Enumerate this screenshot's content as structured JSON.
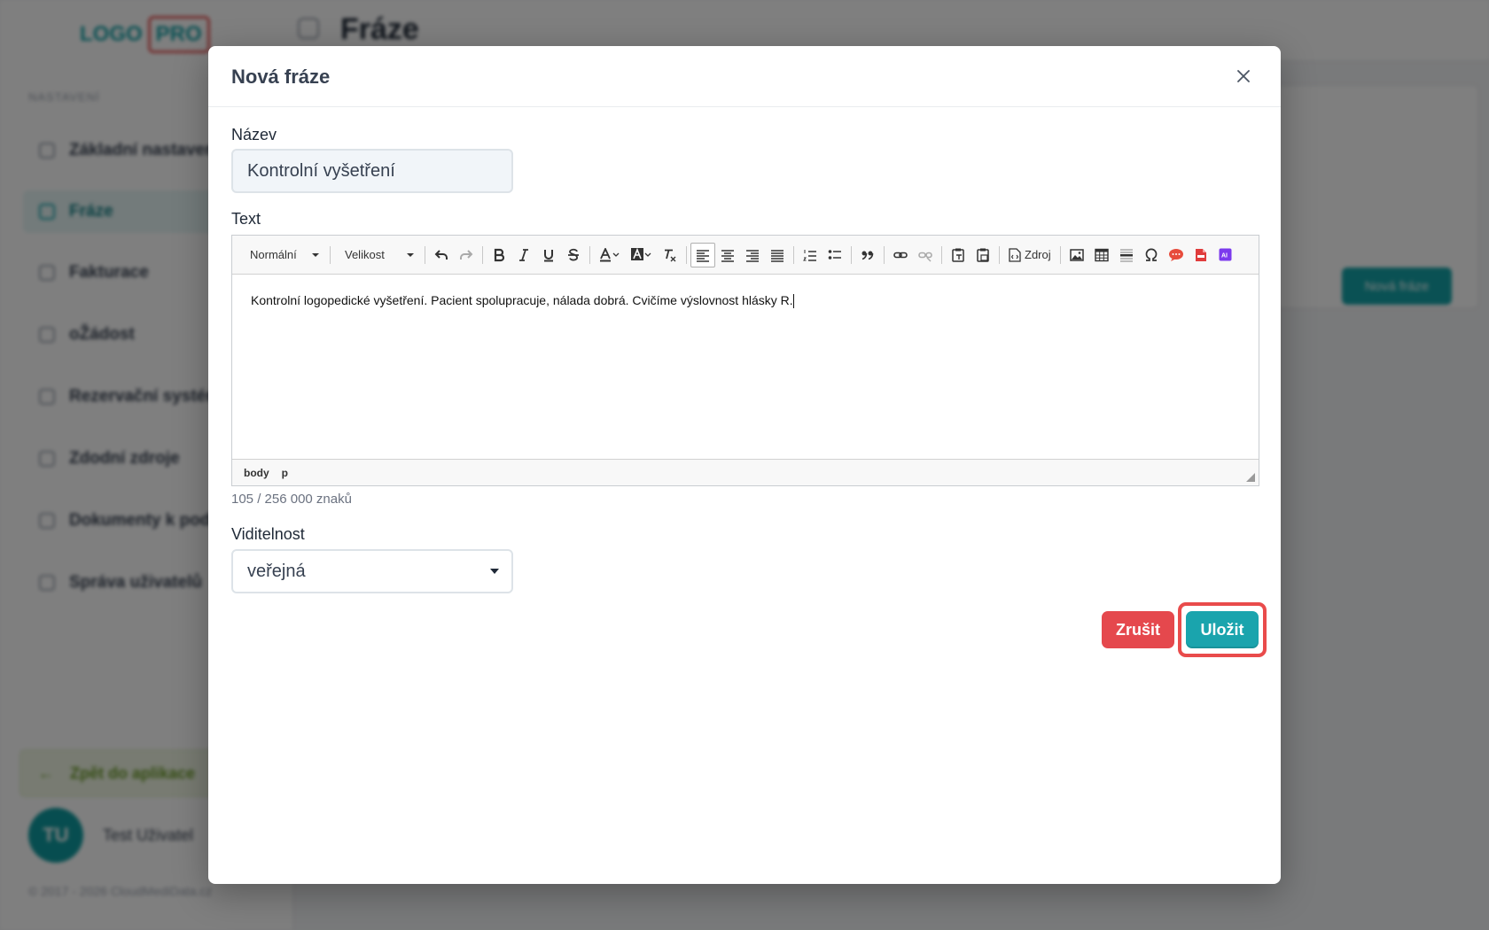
{
  "app": {
    "logo_part1": "LOGO",
    "logo_part2": "PRO",
    "page_title": "Fráze",
    "nav_heading": "NASTAVENÍ",
    "nav_items": [
      {
        "label": "Základní nastavení"
      },
      {
        "label": "Fráze"
      },
      {
        "label": "Fakturace"
      },
      {
        "label": "oŽádost"
      },
      {
        "label": "Rezervační systém"
      },
      {
        "label": "Zdodní zdroje"
      },
      {
        "label": "Dokumenty k podpisu"
      },
      {
        "label": "Správa uživatelů"
      }
    ],
    "back_link": "Zpět do aplikace",
    "user_initials": "TU",
    "user_name": "Test Uživatel",
    "copyright": "© 2017 - 2026 CloudMediData.cz",
    "new_button": "Nová fráze"
  },
  "modal": {
    "title": "Nová fráze",
    "name_label": "Název",
    "name_value": "Kontrolní vyšetření",
    "text_label": "Text",
    "editor": {
      "format_combo": "Normální",
      "size_combo": "Velikost",
      "source_label": "Zdroj",
      "content": "Kontrolní logopedické vyšetření. Pacient spolupracuje, nálada dobrá. Cvičíme výslovnost hlásky R.",
      "path": [
        "body",
        "p"
      ]
    },
    "char_count": "105 / 256 000 znaků",
    "visibility_label": "Viditelnost",
    "visibility_value": "veřejná",
    "cancel_label": "Zrušit",
    "save_label": "Uložit"
  },
  "colors": {
    "primary": "#1aa4ad",
    "danger": "#e5484d",
    "highlight": "#e94b4b"
  }
}
